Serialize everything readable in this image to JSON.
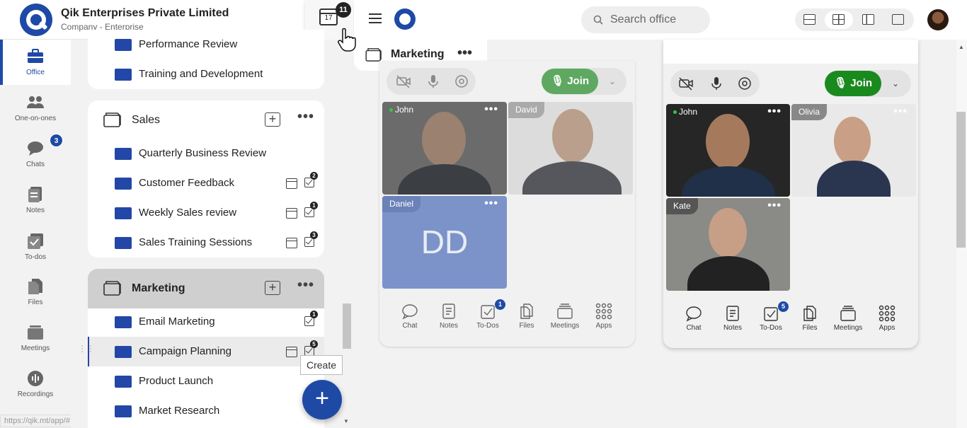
{
  "company": {
    "name": "Qik Enterprises Private Limited",
    "subtitle": "Company - Enterprise"
  },
  "header": {
    "calendar_day": "17",
    "calendar_badge": "11"
  },
  "nav": {
    "items": [
      {
        "label": "Office"
      },
      {
        "label": "One-on-ones"
      },
      {
        "label": "Chats",
        "badge": "3"
      },
      {
        "label": "Notes"
      },
      {
        "label": "To-dos"
      },
      {
        "label": "Files"
      },
      {
        "label": "Meetings"
      },
      {
        "label": "Recordings"
      }
    ]
  },
  "status_url": "https://qik.mt/app/#",
  "tree": {
    "top_rows": [
      {
        "label": "Performance Review"
      },
      {
        "label": "Training and Development"
      }
    ],
    "sales": {
      "name": "Sales",
      "rows": [
        {
          "label": "Quarterly Business Review"
        },
        {
          "label": "Customer Feedback",
          "count": "2"
        },
        {
          "label": "Weekly Sales review",
          "count": "1"
        },
        {
          "label": "Sales Training Sessions",
          "count": "3"
        }
      ]
    },
    "marketing": {
      "name": "Marketing",
      "rows": [
        {
          "label": "Email Marketing",
          "count": "1"
        },
        {
          "label": "Campaign Planning",
          "count": "5"
        },
        {
          "label": "Product Launch"
        },
        {
          "label": "Market Research"
        }
      ]
    }
  },
  "create_tooltip": "Create",
  "topbar": {
    "search_placeholder": "Search office"
  },
  "meeting_tab": {
    "title": "Marketing"
  },
  "panel1": {
    "join_label": "Join",
    "participants": [
      {
        "name": "John"
      },
      {
        "name": "David"
      },
      {
        "name": "Daniel",
        "initials": "DD"
      }
    ],
    "toolbar": [
      {
        "label": "Chat"
      },
      {
        "label": "Notes"
      },
      {
        "label": "To-Dos",
        "badge": "1"
      },
      {
        "label": "Files"
      },
      {
        "label": "Meetings"
      },
      {
        "label": "Apps"
      }
    ]
  },
  "panel2": {
    "join_label": "Join",
    "participants": [
      {
        "name": "John"
      },
      {
        "name": "Olivia"
      },
      {
        "name": "Kate"
      }
    ],
    "toolbar": [
      {
        "label": "Chat"
      },
      {
        "label": "Notes"
      },
      {
        "label": "To-Dos",
        "badge": "5"
      },
      {
        "label": "Files"
      },
      {
        "label": "Meetings"
      },
      {
        "label": "Apps"
      }
    ]
  },
  "colors": {
    "brand": "#1e4aa6",
    "join_active": "#1a8a1f",
    "join_muted": "#5fa862",
    "avatar_tile": "#7b93c9"
  }
}
